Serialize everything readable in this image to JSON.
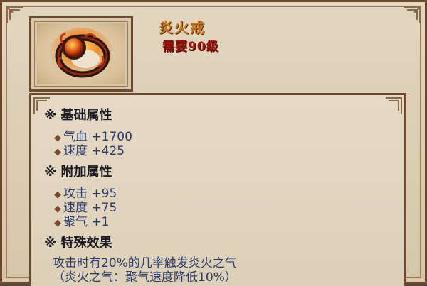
{
  "item": {
    "name": "炎火戒",
    "requirement": "需要90级",
    "icon": "fire-ring-icon"
  },
  "sections": {
    "basic": {
      "title": "基础属性",
      "mark": "※",
      "attrs": [
        "气血 +1700",
        "速度 +425"
      ]
    },
    "bonus": {
      "title": "附加属性",
      "mark": "※",
      "attrs": [
        "攻击 +95",
        "速度 +75",
        "聚气 +1"
      ]
    },
    "special": {
      "title": "特殊效果",
      "mark": "※",
      "lines": [
        "攻击时有20%的几率触发炎火之气",
        "（炎火之气：聚气速度降低10%）"
      ]
    }
  },
  "colors": {
    "name": "#c8781e",
    "requirement": "#a0140c",
    "attribute": "#2a3a6a",
    "panel": "#e3d6c0",
    "border": "#6b4a2d"
  }
}
